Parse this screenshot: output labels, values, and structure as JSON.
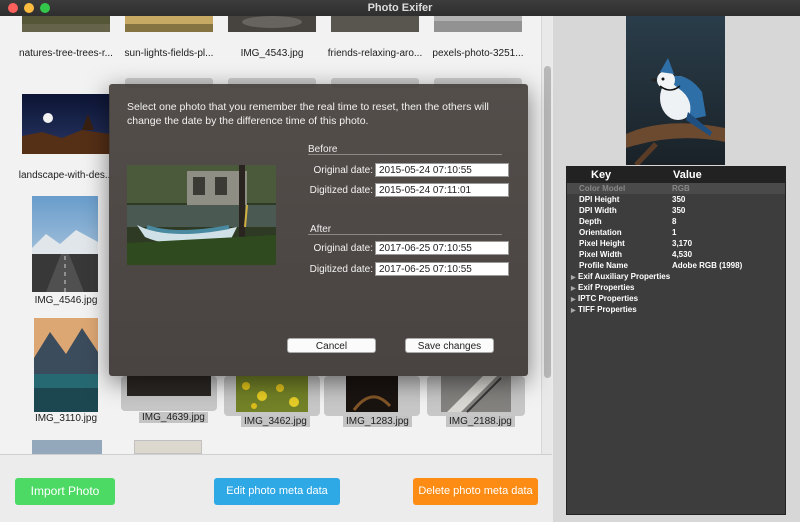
{
  "window": {
    "title": "Photo Exifer"
  },
  "grid": {
    "row1": [
      {
        "name": "natures-tree-trees-r..."
      },
      {
        "name": "sun-lights-fields-pl..."
      },
      {
        "name": "IMG_4543.jpg"
      },
      {
        "name": "friends-relaxing-aro..."
      },
      {
        "name": "pexels-photo-3251..."
      }
    ],
    "row2": [
      {
        "name": "landscape-with-des..."
      }
    ],
    "row3": [
      {
        "name": "IMG_4546.jpg"
      }
    ],
    "row4": [
      {
        "name": "IMG_3110.jpg"
      },
      {
        "name": "IMG_4639.jpg"
      },
      {
        "name": "IMG_3462.jpg"
      },
      {
        "name": "IMG_1283.jpg"
      },
      {
        "name": "IMG_2188.jpg"
      }
    ]
  },
  "toolbar": {
    "import_label": "Import Photo",
    "edit_label": "Edit photo meta data",
    "delete_label": "Delete photo meta data"
  },
  "colors": {
    "import": "#4cd964",
    "edit": "#2ea9e6",
    "delete": "#fd8c14"
  },
  "metadata": {
    "header_key": "Key",
    "header_value": "Value",
    "rows": [
      {
        "key": "Color Model",
        "value": "RGB"
      },
      {
        "key": "DPI Height",
        "value": "350"
      },
      {
        "key": "DPI Width",
        "value": "350"
      },
      {
        "key": "Depth",
        "value": "8"
      },
      {
        "key": "Orientation",
        "value": "1"
      },
      {
        "key": "Pixel Height",
        "value": "3,170"
      },
      {
        "key": "Pixel Width",
        "value": "4,530"
      },
      {
        "key": "Profile Name",
        "value": "Adobe RGB (1998)"
      }
    ],
    "groups": [
      {
        "key": "Exif Auxiliary Properties"
      },
      {
        "key": "Exif Properties"
      },
      {
        "key": "IPTC Properties"
      },
      {
        "key": "TIFF Properties"
      }
    ]
  },
  "dialog": {
    "message": "Select one photo that you remember the real time to reset, then the others will change the date by the difference time of this photo.",
    "before_label": "Before",
    "after_label": "After",
    "original_label": "Original date:",
    "digitized_label": "Digitized date:",
    "before_original": "2015-05-24 07:10:55",
    "before_digitized": "2015-05-24 07:11:01",
    "after_original": "2017-06-25 07:10:55",
    "after_digitized": "2017-06-25 07:10:55",
    "cancel_label": "Cancel",
    "save_label": "Save changes"
  }
}
